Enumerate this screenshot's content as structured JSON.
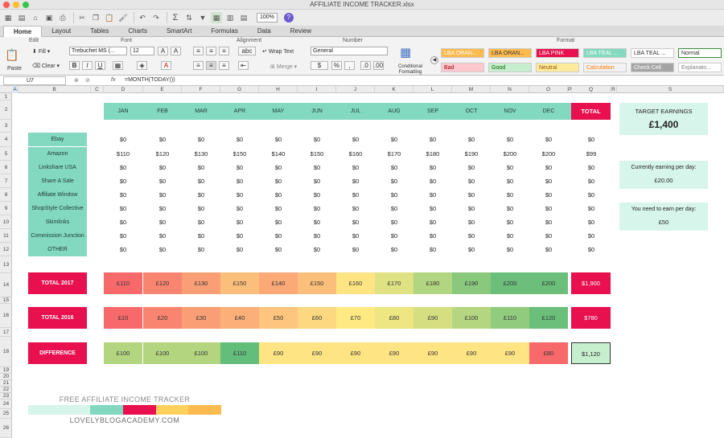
{
  "window": {
    "title": "AFFILIATE INCOME TRACKER.xlsx"
  },
  "toolbar": {
    "zoom": "100%"
  },
  "tabs": [
    "Home",
    "Layout",
    "Tables",
    "Charts",
    "SmartArt",
    "Formulas",
    "Data",
    "Review"
  ],
  "ribbon": {
    "groups": {
      "edit": "Edit",
      "font": "Font",
      "alignment": "Alignment",
      "number": "Number",
      "format": "Format"
    },
    "paste": "Paste",
    "fill": "Fill",
    "clear": "Clear",
    "font_name": "Trebuchet MS (...",
    "font_size": "12",
    "wrap_text": "Wrap Text",
    "merge": "Merge",
    "number_format": "General",
    "conditional": "Conditional Formatting",
    "styles": [
      {
        "label": "LBA ORAN...",
        "bg": "#fdbb4f",
        "fg": "#ffffff"
      },
      {
        "label": "LBA ORAN...",
        "bg": "#fdbb4f",
        "fg": "#333333"
      },
      {
        "label": "LBA PINK",
        "bg": "#e8104f",
        "fg": "#ffffff"
      },
      {
        "label": "LBA TEAL ...",
        "bg": "#83d9bf",
        "fg": "#ffffff"
      },
      {
        "label": "LBA TEAL ...",
        "bg": "#ffffff",
        "fg": "#333333"
      },
      {
        "label": "Normal",
        "bg": "#ffffff",
        "fg": "#333333"
      },
      {
        "label": "Bad",
        "bg": "#ffc7ce",
        "fg": "#9c0006"
      },
      {
        "label": "Good",
        "bg": "#c6efce",
        "fg": "#006100"
      },
      {
        "label": "Neutral",
        "bg": "#ffeb9c",
        "fg": "#9c5700"
      },
      {
        "label": "Calculation",
        "bg": "#f2f2f2",
        "fg": "#fa7d00"
      },
      {
        "label": "Check Cell",
        "bg": "#a5a5a5",
        "fg": "#ffffff"
      },
      {
        "label": "Explanato...",
        "bg": "#ffffff",
        "fg": "#7f7f7f"
      }
    ]
  },
  "formula_bar": {
    "name_box": "U7",
    "fx": "fx",
    "formula": "=MONTH(TODAY())"
  },
  "columns": [
    "A",
    "B",
    "C",
    "D",
    "E",
    "F",
    "G",
    "H",
    "I",
    "J",
    "K",
    "L",
    "M",
    "N",
    "O",
    "P",
    "Q",
    "R",
    "S"
  ],
  "rows": [
    "1",
    "2",
    "3",
    "4",
    "5",
    "6",
    "7",
    "8",
    "9",
    "10",
    "11",
    "12",
    "13",
    "14",
    "15",
    "16",
    "17",
    "18",
    "19",
    "20",
    "21",
    "22",
    "23",
    "24",
    "25",
    "26"
  ],
  "sheet": {
    "months": [
      "JAN",
      "FEB",
      "MAR",
      "APR",
      "MAY",
      "JUN",
      "JUL",
      "AUG",
      "SEP",
      "OCT",
      "NOV",
      "DEC"
    ],
    "total_label": "TOTAL",
    "programs": [
      {
        "name": "Ebay",
        "values": [
          "$0",
          "$0",
          "$0",
          "$0",
          "$0",
          "$0",
          "$0",
          "$0",
          "$0",
          "$0",
          "$0",
          "$0"
        ],
        "total": "$0"
      },
      {
        "name": "Amazon",
        "values": [
          "$110",
          "$120",
          "$130",
          "$150",
          "$140",
          "$150",
          "$160",
          "$170",
          "$180",
          "$190",
          "$200",
          "$200"
        ],
        "total": "$99"
      },
      {
        "name": "Linkshare USA",
        "values": [
          "$0",
          "$0",
          "$0",
          "$0",
          "$0",
          "$0",
          "$0",
          "$0",
          "$0",
          "$0",
          "$0",
          "$0"
        ],
        "total": "$0"
      },
      {
        "name": "Share A Sale",
        "values": [
          "$0",
          "$0",
          "$0",
          "$0",
          "$0",
          "$0",
          "$0",
          "$0",
          "$0",
          "$0",
          "$0",
          "$0"
        ],
        "total": "$0"
      },
      {
        "name": "Affiliate Window",
        "values": [
          "$0",
          "$0",
          "$0",
          "$0",
          "$0",
          "$0",
          "$0",
          "$0",
          "$0",
          "$0",
          "$0",
          "$0"
        ],
        "total": "$0"
      },
      {
        "name": "ShopStyle Collective",
        "values": [
          "$0",
          "$0",
          "$0",
          "$0",
          "$0",
          "$0",
          "$0",
          "$0",
          "$0",
          "$0",
          "$0",
          "$0"
        ],
        "total": "$0"
      },
      {
        "name": "Skimlinks",
        "values": [
          "$0",
          "$0",
          "$0",
          "$0",
          "$0",
          "$0",
          "$0",
          "$0",
          "$0",
          "$0",
          "$0",
          "$0"
        ],
        "total": "$0"
      },
      {
        "name": "Commission Junction",
        "values": [
          "$0",
          "$0",
          "$0",
          "$0",
          "$0",
          "$0",
          "$0",
          "$0",
          "$0",
          "$0",
          "$0",
          "$0"
        ],
        "total": "$0"
      },
      {
        "name": "OTHER",
        "values": [
          "$0",
          "$0",
          "$0",
          "$0",
          "$0",
          "$0",
          "$0",
          "$0",
          "$0",
          "$0",
          "$0",
          "$0"
        ],
        "total": "$0"
      }
    ],
    "summary": [
      {
        "label": "TOTAL 2017",
        "values": [
          "£110",
          "£120",
          "£130",
          "£150",
          "£140",
          "£150",
          "£160",
          "£170",
          "£180",
          "£190",
          "£200",
          "£200"
        ],
        "colors": [
          "#f8696b",
          "#f98570",
          "#fa9f75",
          "#fcbf7b",
          "#fba977",
          "#fcbf7b",
          "#ffe483",
          "#dfe283",
          "#b1d580",
          "#8ac97d",
          "#6bbf7b",
          "#6bbf7b"
        ],
        "total": "$1,900",
        "total_bg": "#e8104f",
        "total_fg": "#ffffff"
      },
      {
        "label": "TOTAL 2016",
        "values": [
          "£10",
          "£20",
          "£30",
          "£40",
          "£50",
          "£60",
          "£70",
          "£80",
          "£90",
          "£100",
          "£110",
          "£120"
        ],
        "colors": [
          "#f8696b",
          "#f98570",
          "#fa9f75",
          "#fcaf79",
          "#fdc57d",
          "#fed880",
          "#ffe983",
          "#eee583",
          "#d5df82",
          "#b5d680",
          "#91cb7e",
          "#6bbf7b"
        ],
        "total": "$780",
        "total_bg": "#e8104f",
        "total_fg": "#ffffff"
      },
      {
        "label": "DIFFERENCE",
        "values": [
          "£100",
          "£100",
          "£100",
          "£110",
          "£90",
          "£90",
          "£90",
          "£90",
          "£90",
          "£90",
          "£90",
          "£80"
        ],
        "colors": [
          "#b3d580",
          "#b3d580",
          "#b3d580",
          "#63be7b",
          "#ffe483",
          "#ffe483",
          "#ffe483",
          "#ffe483",
          "#ffe483",
          "#ffe483",
          "#ffe483",
          "#f8696b"
        ],
        "total": "$1,120",
        "total_bg": "#c6efce",
        "total_fg": "#222222"
      }
    ],
    "target": {
      "label": "TARGET EARNINGS",
      "value": "£1,400"
    },
    "earning": {
      "label": "Currently earning per day:",
      "value": "£20.00"
    },
    "needed": {
      "label": "You need to earn per day:",
      "value": "£50"
    },
    "logo": {
      "title": "FREE AFFILIATE INCOME TRACKER",
      "site": "LOVELYBLOGACADEMY.COM",
      "swatches": [
        "#d7f5ea",
        "#83d9bf",
        "#e8104f",
        "#fdd15c",
        "#fdbb4f"
      ]
    }
  }
}
